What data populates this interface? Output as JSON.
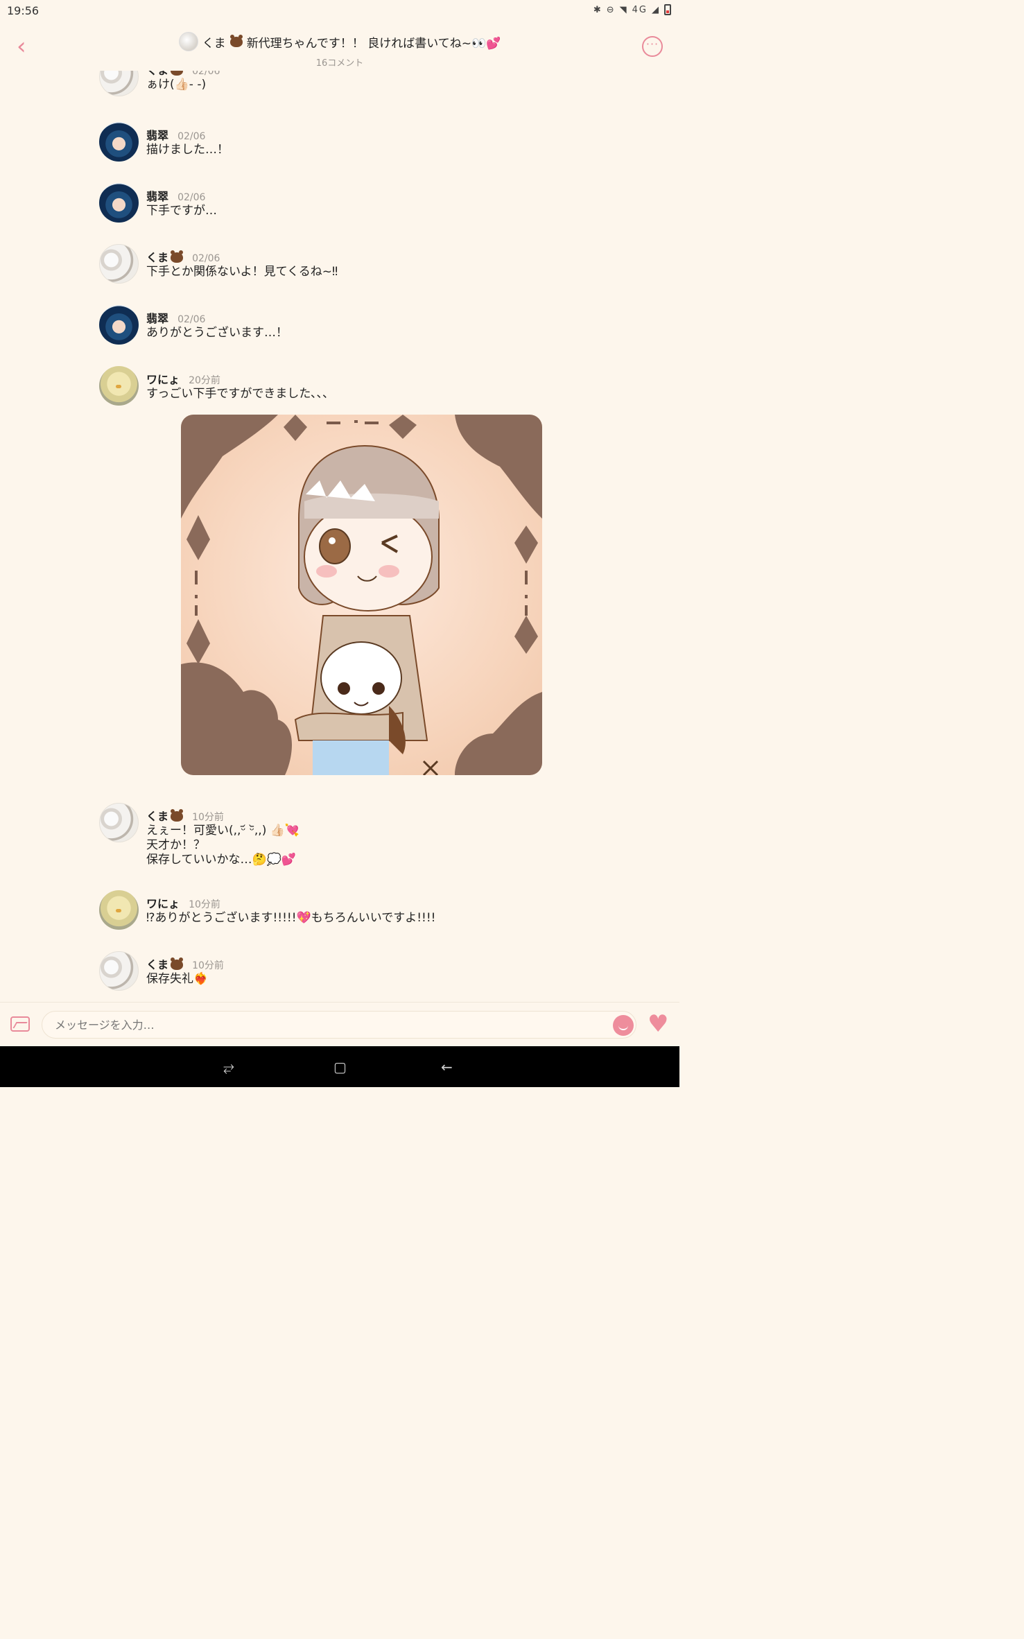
{
  "status_bar": {
    "time": "19:56",
    "network": "4G"
  },
  "header": {
    "back_icon": "chevron-left-icon",
    "title_prefix": "くま",
    "title_text": "新代理ちゃんです！！ 良ければ書いてね~👀💕",
    "subtitle": "16コメント",
    "more_icon": "more-options-icon"
  },
  "messages": [
    {
      "author": "くま",
      "date": "02/06",
      "text": "ぁけ(👍🏻- -)",
      "avatar": "kuma"
    },
    {
      "author": "翡翠",
      "date": "02/06",
      "text": "描けました…！",
      "avatar": "hisui"
    },
    {
      "author": "翡翠",
      "date": "02/06",
      "text": "下手ですが…",
      "avatar": "hisui"
    },
    {
      "author": "くま",
      "date": "02/06",
      "text": "下手とか関係ないよ！見てくるね~‼",
      "avatar": "kuma"
    },
    {
      "author": "翡翠",
      "date": "02/06",
      "text": "ありがとうございます…！",
      "avatar": "hisui"
    },
    {
      "author": "ワにょ",
      "date": "20分前",
      "text": "すっごい下手ですができました､､､",
      "avatar": "wanyo"
    },
    {
      "author": "くま",
      "date": "10分前",
      "text": "えぇー！可愛い‪‪(,,ᵕ᷄ ᵕ᷅,,)‬ 👍🏻💘\n天才か！？\n保存していいかな…🤔💭💕",
      "avatar": "kuma"
    },
    {
      "author": "ワにょ",
      "date": "10分前",
      "text": "⁉ありがとうございます!!!!!💖もちろんいいですよ!!!!",
      "avatar": "wanyo"
    },
    {
      "author": "くま",
      "date": "10分前",
      "text": "保存失礼❤️‍🔥",
      "avatar": "kuma"
    }
  ],
  "input": {
    "placeholder": "メッセージを入力…"
  },
  "colors": {
    "accent": "#e98a9a",
    "background": "#fdf6ec",
    "art_brown": "#8a6a5a"
  }
}
